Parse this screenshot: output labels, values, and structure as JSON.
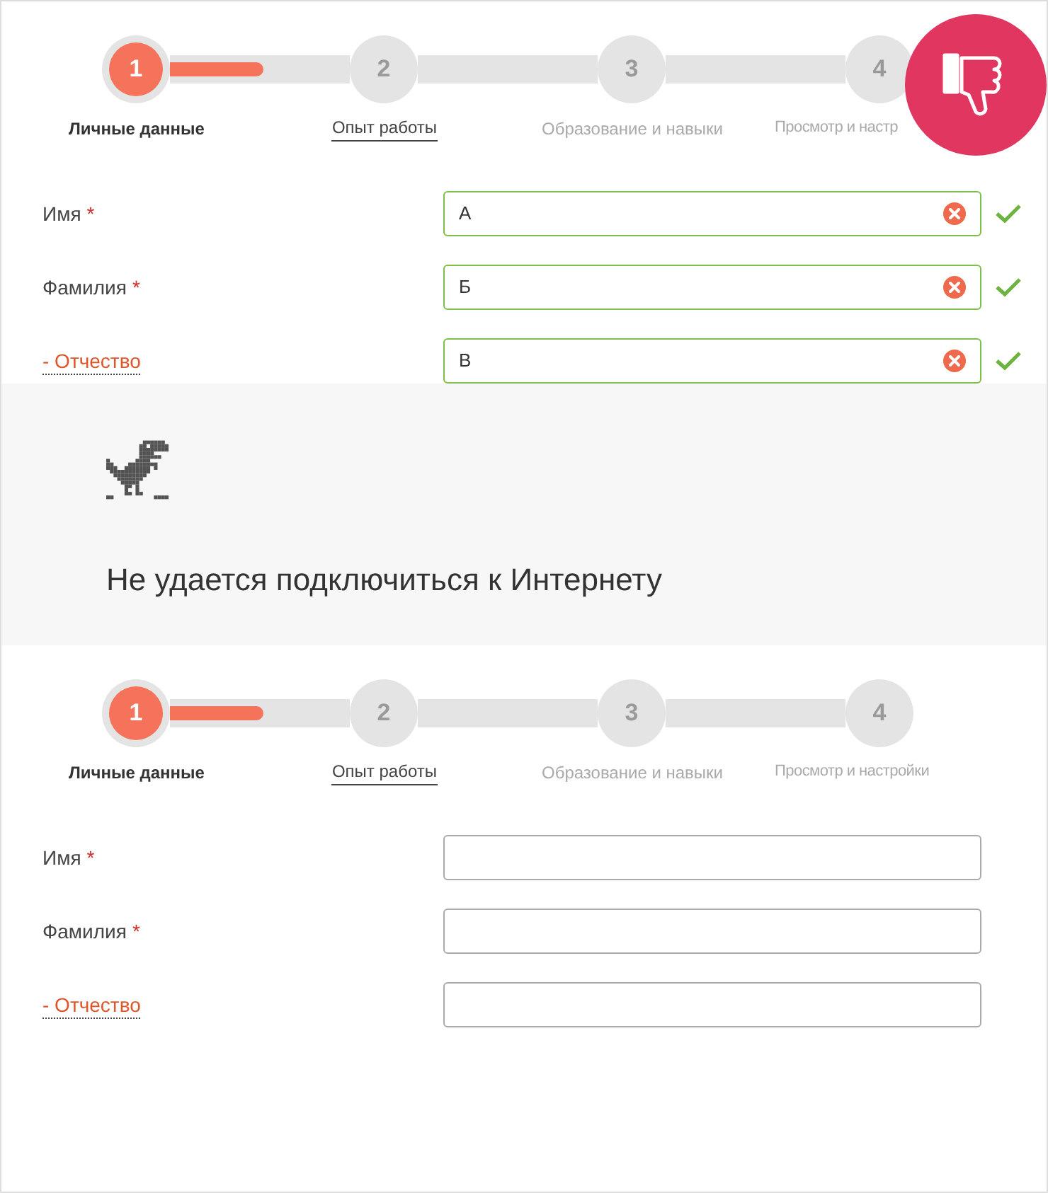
{
  "panels": [
    {
      "badge": {
        "kind": "dislike"
      },
      "progress": {
        "level": 0.52
      },
      "steps": [
        {
          "number": "1",
          "label": "Личные данные",
          "selected": true
        },
        {
          "number": "2",
          "label": "Опыт работы",
          "selected": false,
          "available": true
        },
        {
          "number": "3",
          "label": "Образование и навыки",
          "selected": false,
          "available": false
        },
        {
          "number": "4",
          "label": "Просмотр и настр",
          "selected": false,
          "available": false
        }
      ],
      "fields": [
        {
          "label": "Имя",
          "mark": "*",
          "kind": "required",
          "value": "А",
          "valid": true
        },
        {
          "label": "Фамилия",
          "mark": "*",
          "kind": "required",
          "value": "Б",
          "valid": true
        },
        {
          "label": "- Отчество",
          "kind": "optional",
          "value": "В",
          "valid": true
        }
      ]
    },
    {
      "error": {
        "message": "Не удается подключиться к Интернету"
      }
    },
    {
      "progress": {
        "level": 0.52
      },
      "steps": [
        {
          "number": "1",
          "label": "Личные данные",
          "selected": true
        },
        {
          "number": "2",
          "label": "Опыт работы",
          "selected": false,
          "available": true
        },
        {
          "number": "3",
          "label": "Образование и навыки",
          "selected": false,
          "available": false
        },
        {
          "number": "4",
          "label": "Просмотр и настройки",
          "selected": false,
          "available": false
        }
      ],
      "fields": [
        {
          "label": "Имя",
          "mark": "*",
          "kind": "required",
          "valid": false
        },
        {
          "label": "Фамилия",
          "mark": "*",
          "kind": "required",
          "valid": false
        },
        {
          "label": "- Отчество",
          "kind": "optional",
          "valid": false
        }
      ]
    }
  ]
}
